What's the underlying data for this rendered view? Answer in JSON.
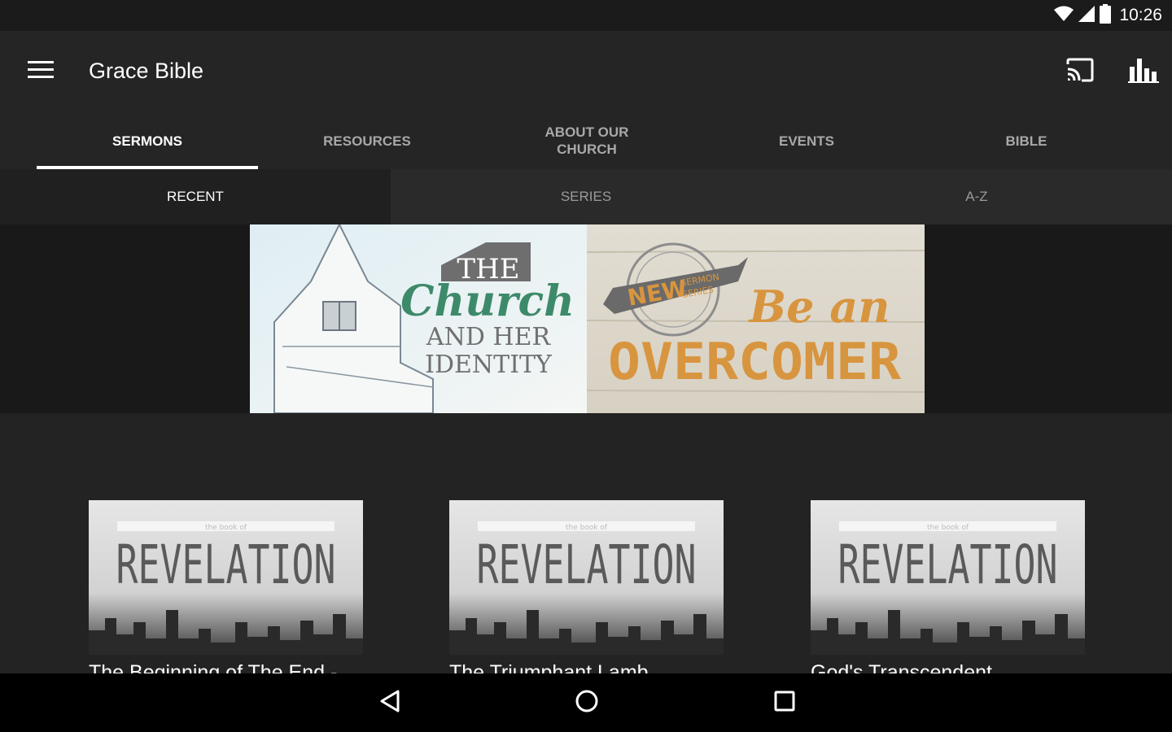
{
  "status_bar": {
    "time": "10:26"
  },
  "app_bar": {
    "title": "Grace Bible",
    "icons": {
      "menu": "hamburger-menu-icon",
      "cast": "cast-icon",
      "stats": "bar-chart-icon"
    }
  },
  "main_tabs": [
    {
      "label": "SERMONS",
      "active": true
    },
    {
      "label": "RESOURCES",
      "active": false
    },
    {
      "label": "ABOUT OUR CHURCH",
      "active": false
    },
    {
      "label": "EVENTS",
      "active": false
    },
    {
      "label": "BIBLE",
      "active": false
    }
  ],
  "sub_tabs": [
    {
      "label": "RECENT",
      "active": true
    },
    {
      "label": "SERIES",
      "active": false
    },
    {
      "label": "A-Z",
      "active": false
    }
  ],
  "banner": {
    "left": {
      "the": "THE",
      "church": "Church",
      "and_her": "AND HER",
      "identity": "IDENTITY"
    },
    "right": {
      "new": "NEW",
      "sermon": "SERMON",
      "series": "SERIES",
      "be_an": "Be an",
      "overcomer": "OVERCOMER"
    }
  },
  "sermons": [
    {
      "title": "The Beginning of The End -",
      "thumb_small": "the book of",
      "thumb_main": "REVELATION"
    },
    {
      "title": "The Triumphant Lamb",
      "thumb_small": "the book of",
      "thumb_main": "REVELATION"
    },
    {
      "title": "God's Transcendent",
      "thumb_small": "the book of",
      "thumb_main": "REVELATION"
    }
  ],
  "colors": {
    "app_bar": "#252525",
    "sub_tab_bar": "#2a2a2a",
    "accent_green": "#3d8a6a",
    "accent_orange": "#d8953f"
  }
}
